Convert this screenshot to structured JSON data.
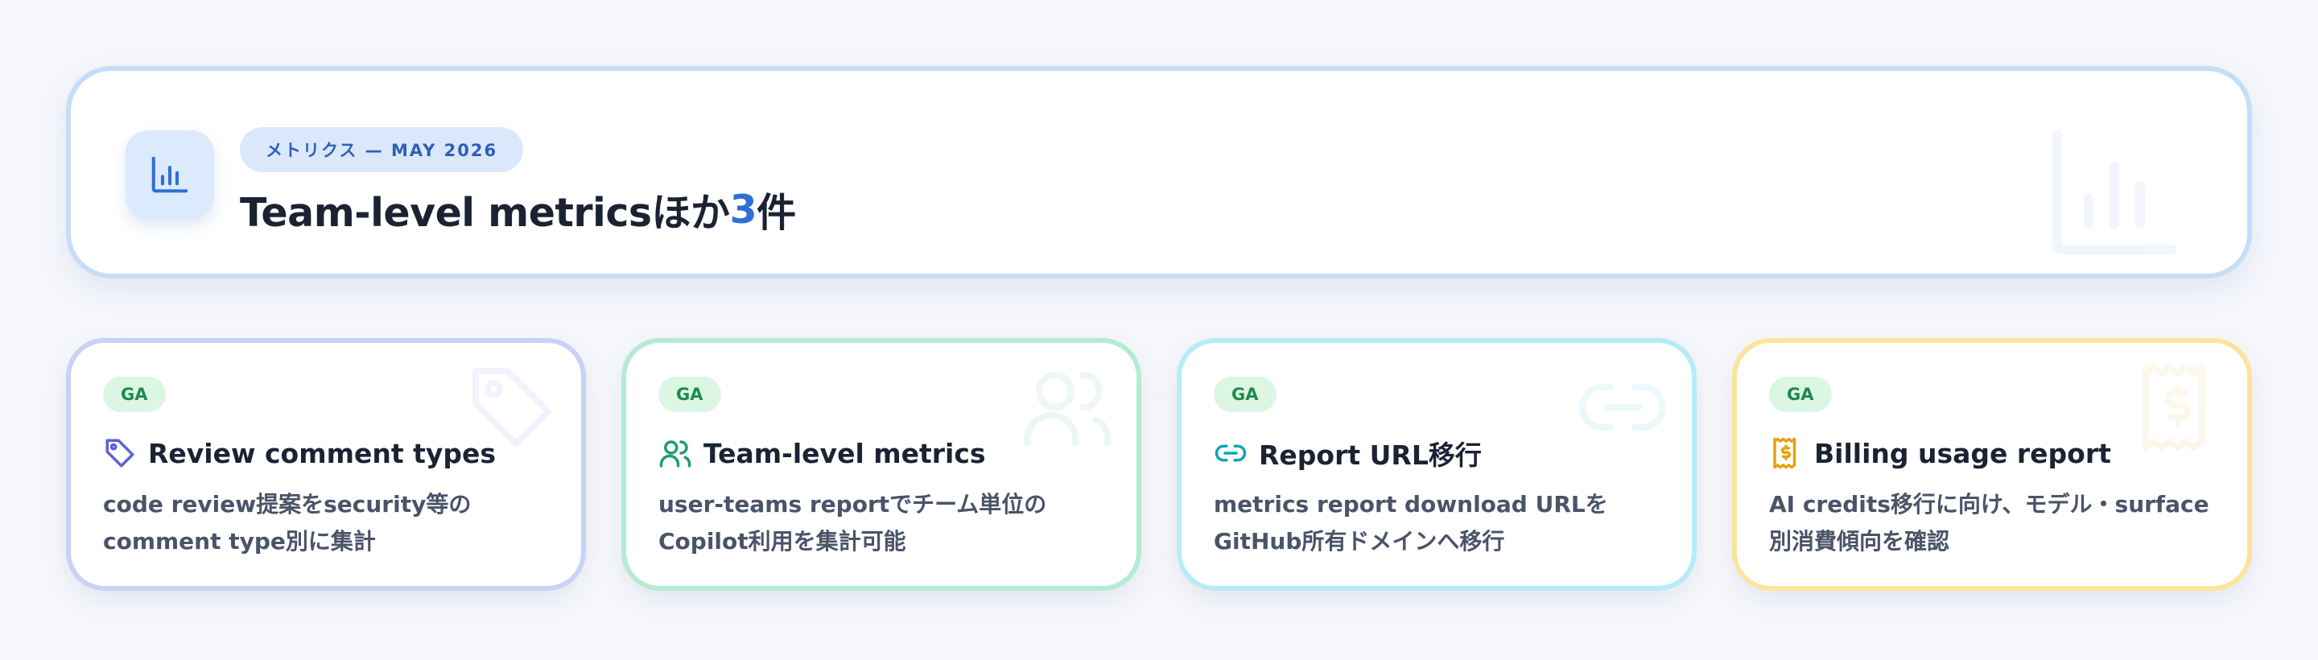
{
  "hero": {
    "kicker": "メトリクス — MAY 2026",
    "title_main": "Team-level metricsほか",
    "title_count": "3",
    "title_suffix": "件",
    "icon": "bar-chart-icon",
    "accent_color": "#2f6fd6"
  },
  "cards": [
    {
      "badge": "GA",
      "icon": "tag-icon",
      "icon_color": "#5b63d9",
      "title": "Review comment types",
      "desc": "code review提案をsecurity等のcomment type別に集計"
    },
    {
      "badge": "GA",
      "icon": "users-icon",
      "icon_color": "#1f9e6e",
      "title": "Team-level metrics",
      "desc": "user-teams reportでチーム単位のCopilot利用を集計可能"
    },
    {
      "badge": "GA",
      "icon": "link-icon",
      "icon_color": "#0ea5b5",
      "title": "Report URL移行",
      "desc": "metrics report download URLをGitHub所有ドメインへ移行"
    },
    {
      "badge": "GA",
      "icon": "billing-icon",
      "icon_color": "#e6a20f",
      "title": "Billing usage report",
      "desc": "AI credits移行に向け、モデル・surface別消費傾向を確認"
    }
  ]
}
